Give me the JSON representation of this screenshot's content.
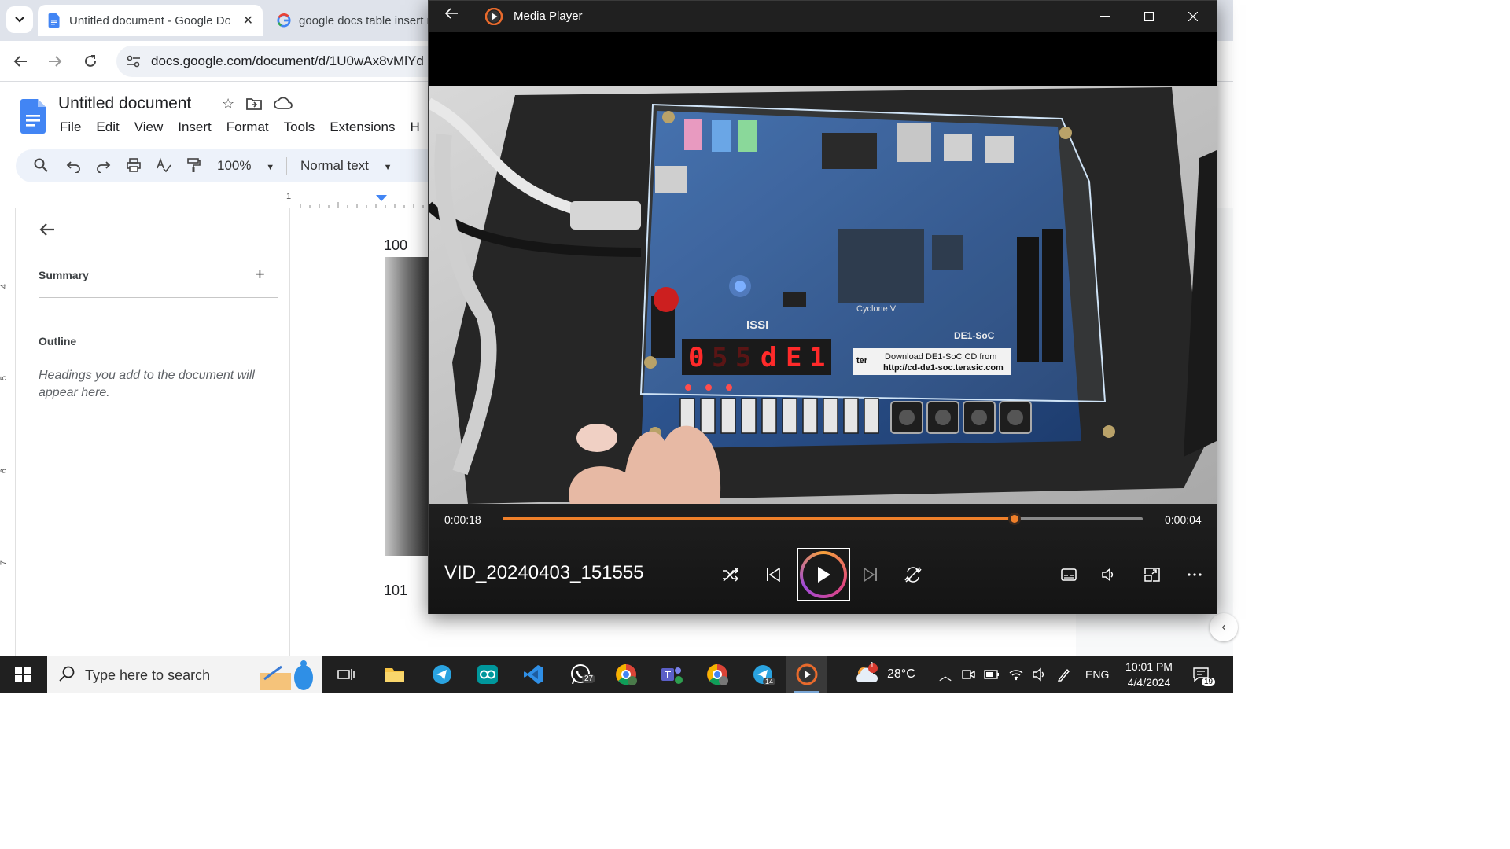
{
  "browser": {
    "tabs": [
      {
        "title": "Untitled document - Google Docs",
        "active": true
      },
      {
        "title": "google docs table insert m",
        "active": false
      }
    ],
    "url": "docs.google.com/document/d/1U0wAx8vMlYd"
  },
  "docs": {
    "title": "Untitled document",
    "menu": [
      "File",
      "Edit",
      "View",
      "Insert",
      "Format",
      "Tools",
      "Extensions",
      "H"
    ],
    "zoom": "100%",
    "style": "Normal text",
    "ruler_top_label": "1",
    "ruler_left_labels": [
      "4",
      "5",
      "6",
      "7"
    ],
    "outline": {
      "summary_label": "Summary",
      "outline_label": "Outline",
      "hint": "Headings you add to the document will appear here."
    },
    "page_numbers": [
      "100",
      "101"
    ]
  },
  "media_player": {
    "app_title": "Media Player",
    "elapsed": "0:00:18",
    "remaining": "0:00:04",
    "progress": 0.8,
    "video_name": "VID_20240403_151555",
    "board": {
      "display": [
        "0",
        "5",
        "5",
        "d",
        "E",
        "1"
      ],
      "sticker_line1": "Download DE1-SoC CD from",
      "sticker_line2": "http://cd-de1-soc.terasic.com",
      "brand_text": "Cyclone V",
      "label_model": "DE1-SoC",
      "label_issi": "ISSI",
      "label_ter": "ter"
    }
  },
  "taskbar": {
    "search_placeholder": "Type here to search",
    "weather": "28°C",
    "weather_badge": "1",
    "language": "ENG",
    "time": "10:01 PM",
    "date": "4/4/2024",
    "notifications": "19",
    "badges": {
      "whatsapp": "27",
      "telegram2": "14"
    }
  },
  "colors": {
    "accent_orange": "#f0802a",
    "docs_blue": "#4285f4"
  }
}
